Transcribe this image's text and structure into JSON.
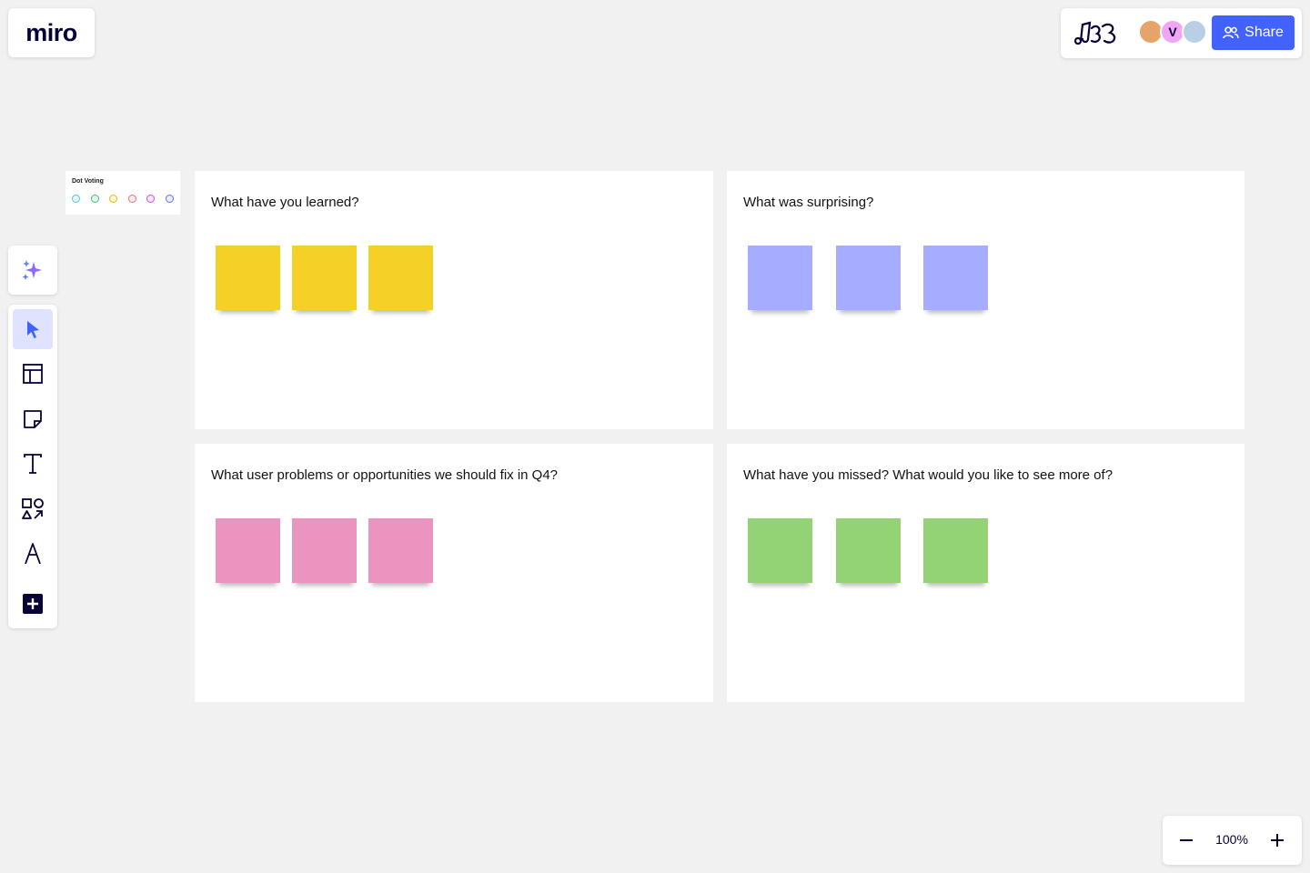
{
  "app": {
    "logo_text": "miro"
  },
  "header": {
    "share_label": "Share",
    "avatars": [
      {
        "name": "user-avatar-1",
        "initial": "",
        "color": "#e6a46a"
      },
      {
        "name": "user-avatar-2",
        "initial": "V",
        "color": "#f0a6f5"
      },
      {
        "name": "user-avatar-3",
        "initial": "",
        "color": "#b9cfe6"
      }
    ],
    "share_color": "#4262ff"
  },
  "toolbar": {
    "tools": [
      "select-tool",
      "templates-tool",
      "sticky-note-tool",
      "text-tool",
      "shapes-tool",
      "pen-tool",
      "more-apps-tool"
    ],
    "active_tool": "select-tool",
    "accent": "#4262ff"
  },
  "dot_voting": {
    "title": "Dot Voting",
    "dots": [
      "#4fc3f7",
      "#39c17a",
      "#e6b800",
      "#ef6b7b",
      "#d24fd6",
      "#6b6bf0"
    ]
  },
  "frames": [
    {
      "title": "What have you learned?",
      "sticky_color": "#f5d128",
      "sticky_count": 3
    },
    {
      "title": "What was surprising?",
      "sticky_color": "#a6acff",
      "sticky_count": 3
    },
    {
      "title": "What user problems or opportunities we should fix in Q4?",
      "sticky_color": "#ea94bf",
      "sticky_count": 3
    },
    {
      "title": "What have you missed? What would you like to see more of?",
      "sticky_color": "#93d275",
      "sticky_count": 3
    }
  ],
  "zoom": {
    "level": "100%"
  }
}
